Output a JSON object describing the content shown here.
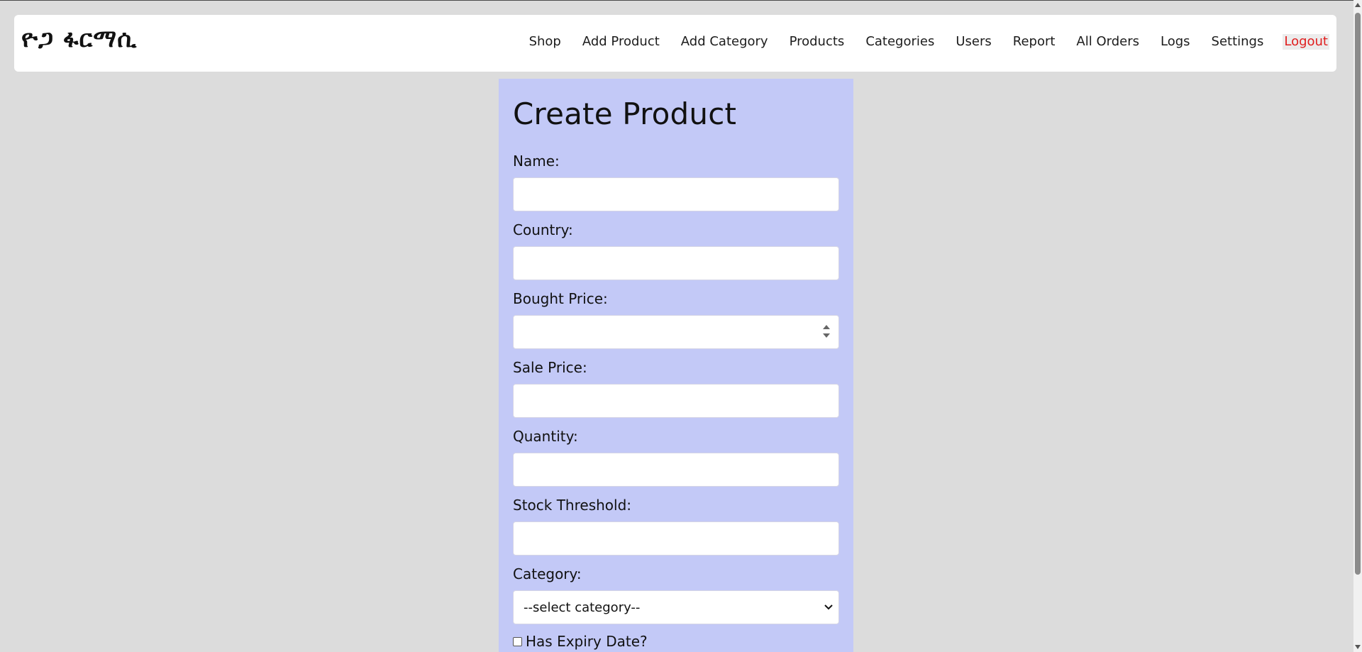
{
  "brand": {
    "name": "ዮጋ ፋርማሲ"
  },
  "nav": {
    "items": [
      {
        "label": "Shop"
      },
      {
        "label": "Add Product"
      },
      {
        "label": "Add Category"
      },
      {
        "label": "Products"
      },
      {
        "label": "Categories"
      },
      {
        "label": "Users"
      },
      {
        "label": "Report"
      },
      {
        "label": "All Orders"
      },
      {
        "label": "Logs"
      },
      {
        "label": "Settings"
      }
    ],
    "logout": {
      "label": "Logout",
      "color": "#e01e1e"
    }
  },
  "form": {
    "title": "Create Product",
    "background": "#c3c9f7",
    "fields": {
      "name": {
        "label": "Name:",
        "value": ""
      },
      "country": {
        "label": "Country:",
        "value": ""
      },
      "bought_price": {
        "label": "Bought Price:",
        "value": ""
      },
      "sale_price": {
        "label": "Sale Price:",
        "value": ""
      },
      "quantity": {
        "label": "Quantity:",
        "value": ""
      },
      "stock_threshold": {
        "label": "Stock Threshold:",
        "value": ""
      },
      "category": {
        "label": "Category:",
        "selected": "--select category--"
      }
    },
    "has_expiry": {
      "label": "Has Expiry Date?",
      "checked": false
    }
  }
}
